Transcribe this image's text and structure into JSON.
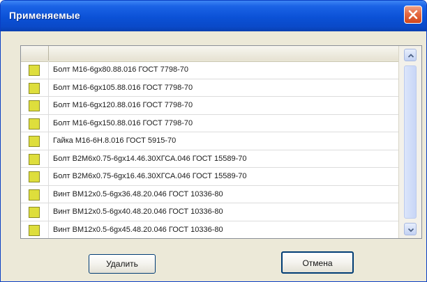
{
  "window": {
    "title": "Применяемые"
  },
  "list": {
    "items": [
      {
        "label": "Болт М16-6gx80.88.016 ГОСТ 7798-70"
      },
      {
        "label": "Болт М16-6gx105.88.016 ГОСТ 7798-70"
      },
      {
        "label": "Болт М16-6gx120.88.016 ГОСТ 7798-70"
      },
      {
        "label": "Болт М16-6gx150.88.016 ГОСТ 7798-70"
      },
      {
        "label": "Гайка М16-6Н.8.016 ГОСТ 5915-70"
      },
      {
        "label": "Болт В2М6х0.75-6gx14.46.30ХГСА.046 ГОСТ 15589-70"
      },
      {
        "label": "Болт В2М6х0.75-6gx16.46.30ХГСА.046 ГОСТ 15589-70"
      },
      {
        "label": "Винт ВМ12х0.5-6gx36.48.20.046 ГОСТ 10336-80"
      },
      {
        "label": "Винт ВМ12х0.5-6gx40.48.20.046 ГОСТ 10336-80"
      },
      {
        "label": "Винт ВМ12х0.5-6gx45.48.20.046 ГОСТ 10336-80"
      }
    ]
  },
  "buttons": {
    "delete_label": "Удалить",
    "cancel_label": "Отмена"
  },
  "colors": {
    "titlebar": "#0b51d6",
    "close": "#e66a42",
    "item_box": "#dede3c"
  },
  "icons": {
    "close": "close-icon",
    "scroll_up": "chevron-up-icon",
    "scroll_down": "chevron-down-icon"
  }
}
